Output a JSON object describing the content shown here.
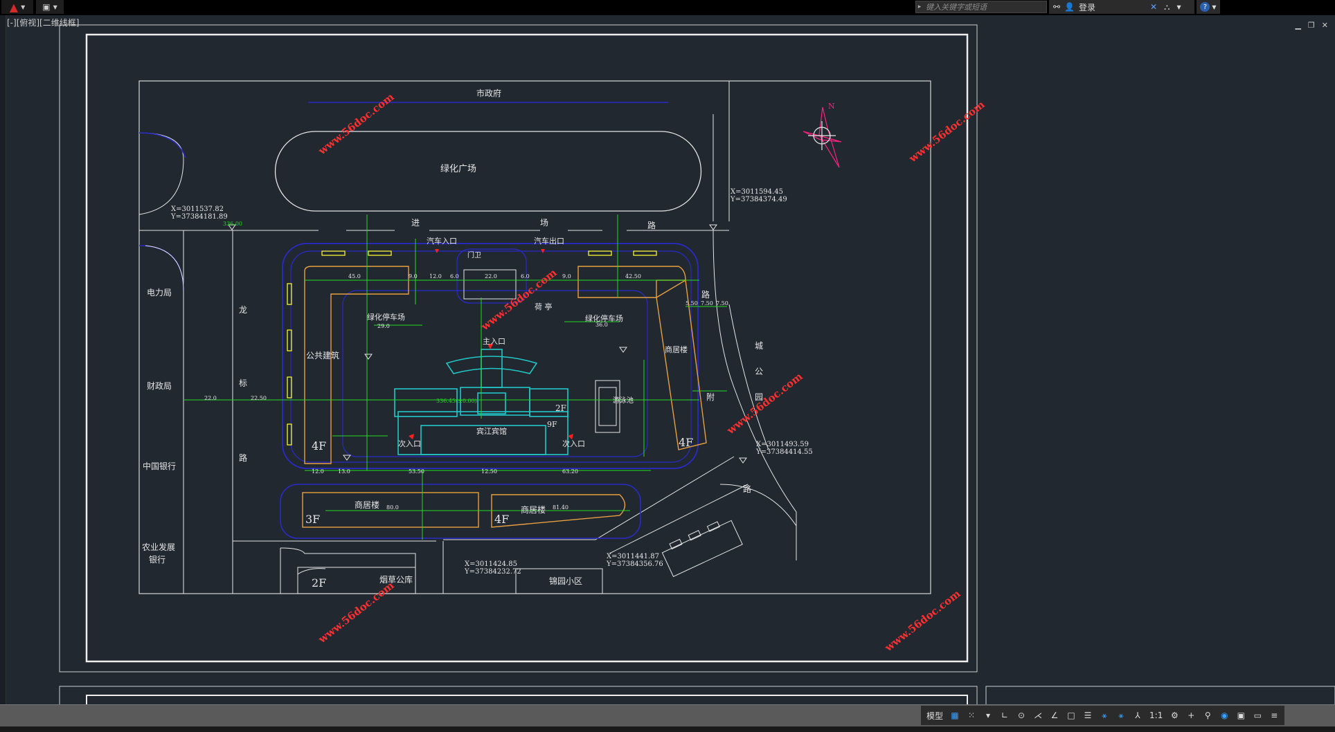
{
  "topbar": {
    "app_icon": "autocad-a-icon",
    "search_placeholder": "键入关键字或短语",
    "signin_label": "登录",
    "view_label": "[-][俯视][二维线框]"
  },
  "drawing_texts": {
    "gov": "市政府",
    "plaza": "绿化广场",
    "road_top1": "进",
    "road_top2": "场",
    "road_top3": "路",
    "car_in": "汽车入口",
    "car_out": "汽车出口",
    "guard": "门卫",
    "jianbao": "荷  亭",
    "green_park_left": "绿化停车场",
    "green_park_right": "绿化停车场",
    "public_bldg": "公共建筑",
    "main_entry": "主入口",
    "commercial_right": "商居楼",
    "dianli": "电力局",
    "caizheng": "财政局",
    "zhongguo": "中国银行",
    "nongye1": "农业发展",
    "nongye2": "银行",
    "long": "龙",
    "biao": "标",
    "lu_left": "路",
    "hotel": "宾江宾馆",
    "pool": "游泳池",
    "side_entry_left": "次入口",
    "side_entry_right": "次入口",
    "f2": "2F",
    "f9": "9F",
    "f4_left": "4F",
    "f4_right": "4F",
    "f3": "3F",
    "f4_bottom": "4F",
    "f2_bottom": "2F",
    "comm_bottom_left": "商居楼",
    "comm_bottom_right": "商居楼",
    "yancao": "烟草公库",
    "jinyuan": "锦园小区",
    "cheng": "城",
    "gong": "公",
    "yuan": "园",
    "fu": "附",
    "lu_right": "路",
    "lu_right2": "路",
    "coord1a": "X=3011537.82",
    "coord1b": "Y=37384181.89",
    "coord2a": "X=3011594.45",
    "coord2b": "Y=37384374.49",
    "coord3a": "X=3011493.59",
    "coord3b": "Y=37384414.55",
    "coord4a": "X=3011424.85",
    "coord4b": "Y=37384232.72",
    "coord5a": "X=3011441.87",
    "coord5b": "Y=37384356.76",
    "wm1": "www.56doc.com",
    "wm2": "www.56doc.com",
    "wm3": "www.56doc.com",
    "wm4": "www.56doc.com",
    "wm5": "www.56doc.com",
    "wm6": "www.56doc.com",
    "north": "N",
    "dim_45": "45.0",
    "dim_9a": "9.0",
    "dim_12": "12.0",
    "dim_6": "6.0",
    "dim_22": "22.0",
    "dim_6b": "6.0",
    "dim_9b": "9.0",
    "dim_4250": "42.50",
    "dim_29": "29.0",
    "dim_36": "36.0",
    "dim_5350": "53.50",
    "dim_1250": "12.50",
    "dim_6320": "63.20",
    "dim_80": "80.0",
    "dim_8140": "81.40",
    "dim_13": "13.0",
    "dim_12b": "12.0",
    "dim_220": "22.0",
    "dim_2250": "22.50",
    "dim_550": "5.50",
    "dim_750": "7.50",
    "dim_750b": "7.50",
    "elev": "336.00",
    "hotel_elev": "336.45(±0.00)"
  },
  "statusbar": {
    "model_label": "模型",
    "scale_label": "1:1"
  },
  "colors": {
    "background": "#212830",
    "white_line": "#e6e6e6",
    "blue_road": "#1a1ab8",
    "green_dim": "#22dd22",
    "yellow": "#e8e830",
    "cyan_hotel": "#21c8c8",
    "orange_bldg": "#e8a040",
    "red_marker": "#ff2020",
    "watermark": "#ff3030"
  }
}
